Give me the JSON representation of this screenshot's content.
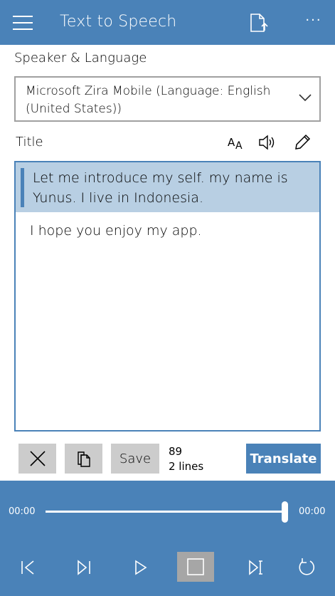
{
  "header": {
    "title": "Text to Speech",
    "icons": [
      "hamburger-icon",
      "open-file-icon",
      "more-icon"
    ],
    "more_label": "···"
  },
  "speaker": {
    "label": "Speaker & Language",
    "selected": "Microsoft Zira Mobile (Language: English (United States))"
  },
  "editor_toolbar": {
    "title_label": "Title",
    "icons": [
      "font-size-icon",
      "speaker-icon",
      "pencil-icon"
    ]
  },
  "editor": {
    "highlighted_line": "Let me introduce my self. my name is Yunus. I live in Indonesia.",
    "line2": "I hope you enjoy my app."
  },
  "actions": {
    "clear_icon": "close-icon",
    "copy_icon": "copy-icon",
    "save_label": "Save",
    "char_count": "89",
    "line_count": "2 lines",
    "translate_label": "Translate"
  },
  "player": {
    "time_start": "00:00",
    "time_end": "00:00",
    "progress": 1.0,
    "controls": [
      "skip-back-icon",
      "prev-icon",
      "play-icon",
      "stop-icon",
      "next-icon",
      "repeat-icon"
    ]
  },
  "colors": {
    "accent": "#4a82b8",
    "highlight": "#b8cfe3",
    "button_gray": "#cccccc",
    "stop_active": "#a6a6a6"
  }
}
